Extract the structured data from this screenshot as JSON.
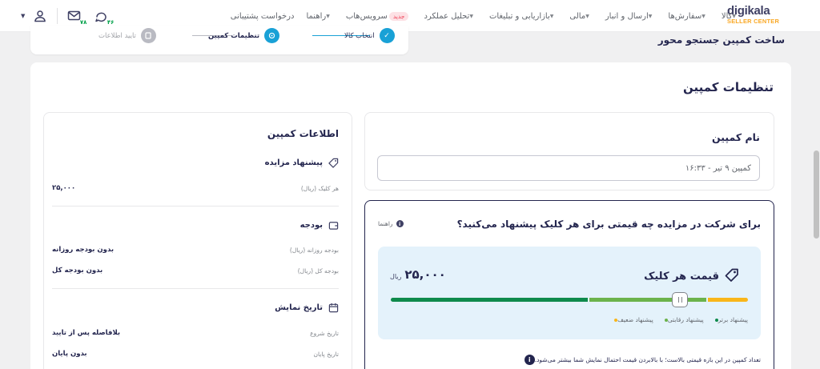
{
  "logo": {
    "brand": "digikala",
    "sub": "SELLER CENTER"
  },
  "nav": [
    {
      "label": "کالا",
      "chevron": true
    },
    {
      "label": "سفارش‌ها",
      "chevron": true
    },
    {
      "label": "ارسال و انبار",
      "chevron": true
    },
    {
      "label": "مالی",
      "chevron": true
    },
    {
      "label": "بازاریابی و تبلیغات",
      "chevron": true
    },
    {
      "label": "تحلیل عملکرد",
      "chevron": true
    },
    {
      "label": "سرویس‌هاب",
      "chevron": false,
      "badge": "جدید"
    },
    {
      "label": "راهنما",
      "chevron": true
    },
    {
      "label": "درخواست پشتیبانی",
      "chevron": false
    }
  ],
  "top_icons": {
    "support_count": "۴۶",
    "messages_count": "۷۸"
  },
  "stepper": {
    "steps": [
      "انتخاب کالا",
      "تنظیمات کمپین",
      "تایید اطلاعات"
    ],
    "colors": {
      "active": "#19a1d6",
      "done": "#19a1d6",
      "pending": "#b9bac2"
    }
  },
  "page_title": "ساخت کمپین جستجو محور",
  "main_title": "تنظیمات کمپین",
  "name_card": {
    "title": "نام کمپین",
    "value": "کمپین ۹ تیر - ۱۶:۳۳"
  },
  "bid_card": {
    "question": "برای شرکت در مزایده چه قیمتی برای هر کلیک پیشنهاد می‌کنید؟",
    "guide": "راهنما",
    "price_label": "قیمت هر کلیک",
    "price_value": "۲۵,۰۰۰",
    "price_unit": "ریال",
    "slider_fraction": 0.19,
    "legend": [
      {
        "label": "پیشنهاد ضعیف",
        "color": "#f9b61a"
      },
      {
        "label": "پیشنهاد رقابتی",
        "color": "#6bb34b"
      },
      {
        "label": "پیشنهاد برتر",
        "color": "#0e8a4c"
      }
    ],
    "note": "تعداد کمپین در این بازه قیمتی بالاست؛ با بالابردن قیمت احتمال نمایش شما بیشتر می‌شود."
  },
  "info": {
    "title": "اطلاعات کمپین",
    "bid_section": "پیشنهاد مزایده",
    "per_click_label": "هر کلیک (ریال)",
    "per_click_value": "۲۵,۰۰۰",
    "budget_section": "بودجه",
    "daily_budget_label": "بودجه روزانه (ریال)",
    "daily_budget_value": "بدون بودجه روزانه",
    "total_budget_label": "بودجه کل (ریال)",
    "total_budget_value": "بدون بودجه کل",
    "date_section": "تاریخ نمایش",
    "start_label": "تاریخ شروع",
    "start_value": "بلافاصله پس از تایید",
    "end_label": "تاریخ پایان",
    "end_value": "بدون پایان"
  }
}
